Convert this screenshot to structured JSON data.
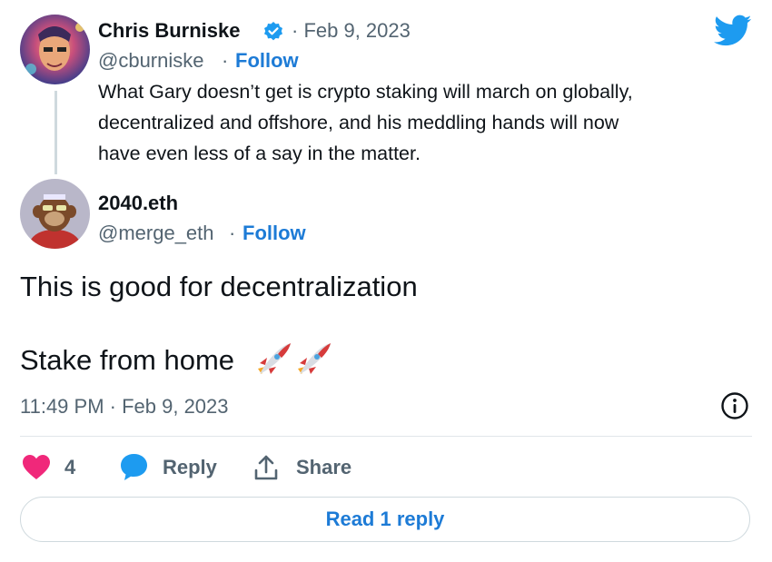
{
  "quoted": {
    "name": "Chris Burniske",
    "date": "· Feb 9, 2023",
    "handle": "@cburniske",
    "sep": "·",
    "follow": "Follow",
    "text_lines": [
      "What Gary doesn’t get is crypto staking will march on globally,",
      "decentralized and offshore, and his meddling hands will now",
      "have even less of a say in the matter."
    ]
  },
  "tweet": {
    "name": "2040.eth",
    "handle": "@merge_eth",
    "sep": "·",
    "follow": "Follow",
    "line1": "This is good for decentralization",
    "line2": "Stake from home",
    "emoji": "🚀🚀",
    "timestamp": "11:49 PM · Feb 9, 2023"
  },
  "actions": {
    "likes_count": "4",
    "reply": "Reply",
    "share": "Share"
  },
  "read_reply": "Read 1 reply",
  "colors": {
    "accent": "#1d7bd6",
    "like": "#f0287a",
    "twitter_blue": "#1d9bf0"
  },
  "icons": [
    "twitter-bird-icon",
    "verified-badge-icon",
    "info-icon",
    "heart-icon",
    "reply-bubble-icon",
    "share-upload-icon",
    "rocket-icon"
  ]
}
